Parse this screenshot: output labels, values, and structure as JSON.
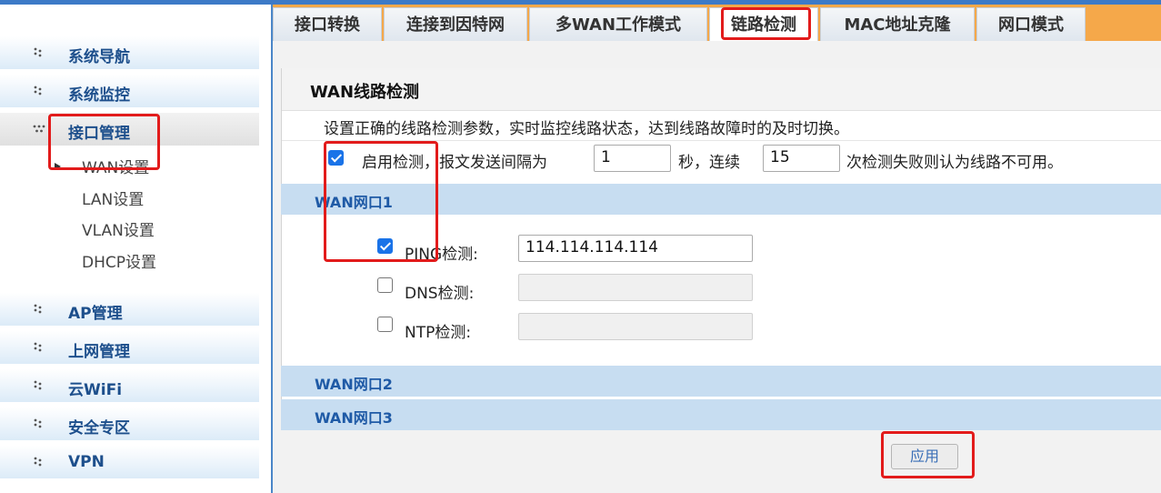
{
  "sidebar": {
    "groups": [
      {
        "label": "系统导航"
      },
      {
        "label": "系统监控"
      },
      {
        "label": "接口管理"
      },
      {
        "label": "AP管理"
      },
      {
        "label": "上网管理"
      },
      {
        "label": "云WiFi"
      },
      {
        "label": "安全专区"
      },
      {
        "label": "VPN"
      }
    ],
    "sub_items": [
      {
        "label": "WAN设置"
      },
      {
        "label": "LAN设置"
      },
      {
        "label": "VLAN设置"
      },
      {
        "label": "DHCP设置"
      }
    ]
  },
  "tabs": [
    {
      "label": "接口转换"
    },
    {
      "label": "连接到因特网"
    },
    {
      "label": "多WAN工作模式"
    },
    {
      "label": "链路检测"
    },
    {
      "label": "MAC地址克隆"
    },
    {
      "label": "网口模式"
    }
  ],
  "panel": {
    "title": "WAN线路检测",
    "description": "设置正确的线路检测参数，实时监控线路状态，达到线路故障时的及时切换。",
    "enable_label": "启用检测，报文发送间隔为",
    "interval_value": "1",
    "seconds_label": "秒，连续",
    "count_value": "15",
    "count_suffix": "次检测失败则认为线路不可用。"
  },
  "wan_sections": [
    {
      "label": "WAN网口1"
    },
    {
      "label": "WAN网口2"
    },
    {
      "label": "WAN网口3"
    }
  ],
  "checks": {
    "ping_label": "PING检测:",
    "ping_value": "114.114.114.114",
    "dns_label": "DNS检测:",
    "ntp_label": "NTP检测:"
  },
  "apply_label": "应用",
  "colors": {
    "accent_tab_bar": "#f5a84a",
    "nav_text": "#1d4f8c",
    "section_bar": "#c7ddf1",
    "highlight": "#e21b1b"
  }
}
